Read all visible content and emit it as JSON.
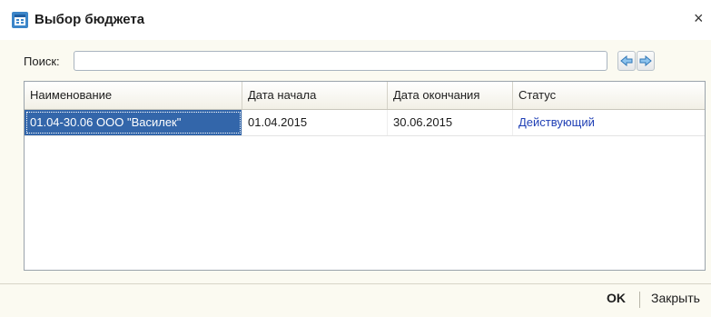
{
  "window": {
    "title": "Выбор бюджета",
    "icon": "budget-table-icon",
    "close_glyph": "×"
  },
  "search": {
    "label": "Поиск:",
    "value": "",
    "placeholder": ""
  },
  "nav": {
    "prev_icon": "arrow-left-icon",
    "next_icon": "arrow-right-icon"
  },
  "grid": {
    "columns": [
      "Наименование",
      "Дата начала",
      "Дата окончания",
      "Статус"
    ],
    "rows": [
      {
        "name": "01.04-30.06 ООО \"Василек\"",
        "start": "01.04.2015",
        "end": "30.06.2015",
        "status": "Действующий"
      }
    ]
  },
  "footer": {
    "ok_label": "OK",
    "close_label": "Закрыть"
  },
  "colors": {
    "selection": "#3366aa",
    "status_link": "#1f3fb5",
    "window_bg": "#fbfaf1"
  }
}
